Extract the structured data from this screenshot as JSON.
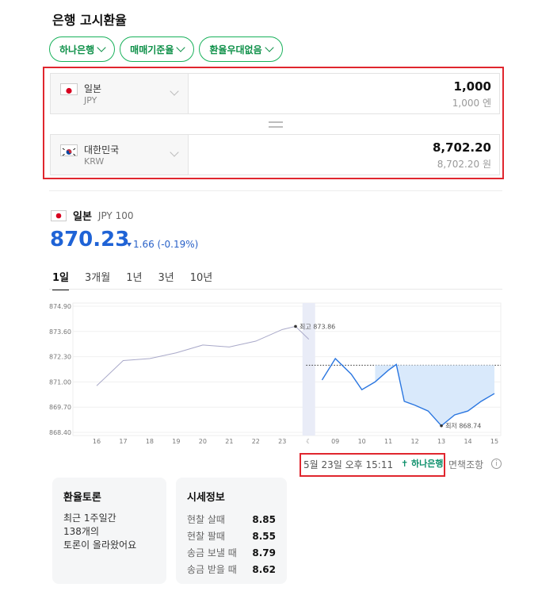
{
  "title": "은행 고시환율",
  "chips": [
    "하나은행",
    "매매기준율",
    "환율우대없음"
  ],
  "converter": {
    "from": {
      "name": "일본",
      "code": "JPY",
      "amount": "1,000",
      "sub": "1,000 엔"
    },
    "to": {
      "name": "대한민국",
      "code": "KRW",
      "amount": "8,702.20",
      "sub": "8,702.20 원"
    }
  },
  "chart_header": {
    "name": "일본",
    "code": "JPY 100",
    "rate": "870.23",
    "change": "1.66 (-0.19%)"
  },
  "tabs": [
    "1일",
    "3개월",
    "1년",
    "3년",
    "10년"
  ],
  "chart_data": {
    "type": "line",
    "yticks": [
      "874.90",
      "873.60",
      "872.30",
      "871.00",
      "869.70",
      "868.40"
    ],
    "ylim": [
      868.4,
      874.9
    ],
    "xticks": [
      "16",
      "17",
      "18",
      "19",
      "20",
      "21",
      "22",
      "23",
      "☾",
      "09",
      "10",
      "11",
      "12",
      "13",
      "14",
      "15"
    ],
    "baseline": 871.86,
    "series": [
      {
        "x": [
          0,
          1,
          2,
          3,
          4,
          5,
          6,
          7,
          7.5,
          8
        ],
        "y": [
          870.8,
          872.1,
          872.2,
          872.5,
          872.9,
          872.8,
          873.1,
          873.7,
          873.86,
          873.2
        ]
      },
      {
        "x": [
          8.5,
          9,
          9.6,
          10,
          10.5,
          11,
          11.3,
          11.6,
          12,
          12.5,
          13,
          13.5,
          14,
          14.5,
          15
        ],
        "y": [
          871.1,
          872.2,
          871.4,
          870.6,
          871.0,
          871.6,
          871.9,
          870.0,
          869.8,
          869.5,
          868.74,
          869.3,
          869.5,
          870.0,
          870.4
        ]
      }
    ],
    "annotations": [
      {
        "label": "최고 873.86",
        "x": 7.5,
        "y": 873.86
      },
      {
        "label": "최저 868.74",
        "x": 13,
        "y": 868.74
      }
    ]
  },
  "stamp": {
    "text": "5월 23일 오후 15:11",
    "bank": "하나은행",
    "disclaimer": "면책조항",
    "info": "i"
  },
  "card1": {
    "title": "환율토론",
    "l1": "최근 1주일간",
    "l2": "138개의",
    "l3": "토론이 올라왔어요"
  },
  "card2": {
    "title": "시세정보",
    "rows": [
      {
        "label": "현찰 살때",
        "value": "8.85"
      },
      {
        "label": "현찰 팔때",
        "value": "8.55"
      },
      {
        "label": "송금 보낼 때",
        "value": "8.79"
      },
      {
        "label": "송금 받을 때",
        "value": "8.62"
      }
    ]
  }
}
